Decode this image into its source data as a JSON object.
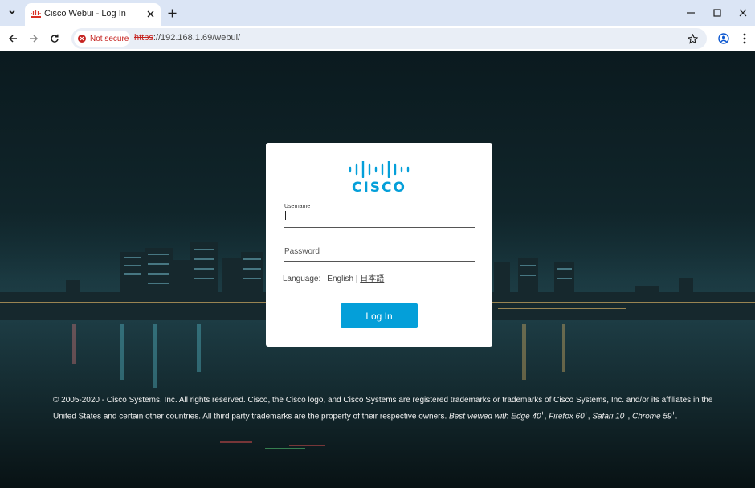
{
  "browser": {
    "tab_title": "Cisco Webui - Log In",
    "security_label": "Not secure",
    "url_scheme": "https",
    "url_rest": "://192.168.1.69/webui/"
  },
  "icons": {
    "tab_menu": "chevron-down-icon",
    "favicon": "cisco-favicon-icon",
    "tab_close": "close-icon",
    "new_tab": "plus-icon",
    "minimize": "minimize-icon",
    "maximize": "maximize-icon",
    "close_window": "close-icon",
    "back": "arrow-left-icon",
    "forward": "arrow-right-icon",
    "reload": "reload-icon",
    "security": "warning-icon",
    "bookmark": "star-icon",
    "profile": "profile-icon",
    "menu": "kebab-menu-icon"
  },
  "login": {
    "logo_text": "CISCO",
    "username_label": "Username",
    "username_value": "",
    "password_placeholder": "Password",
    "language_label": "Language:",
    "language_current": "English",
    "language_separator": "|",
    "language_alt": "日本語",
    "login_button": "Log In"
  },
  "footer": {
    "copyright": "© 2005-2020 - Cisco Systems, Inc. All rights reserved. Cisco, the Cisco logo, and Cisco Systems are registered trademarks or trademarks of Cisco Systems, Inc. and/or its affiliates in the United States and certain other countries. All third party trademarks are the property of their respective owners.",
    "best_viewed": "Best viewed with Edge 40",
    "firefox": "Firefox 60",
    "safari": "Safari 10",
    "chrome": "Chrome 59",
    "plus": "+",
    "comma": ",",
    "period": "."
  },
  "colors": {
    "accent": "#049fd9",
    "tabstrip": "#dbe5f5",
    "insecure": "#c5221f"
  }
}
